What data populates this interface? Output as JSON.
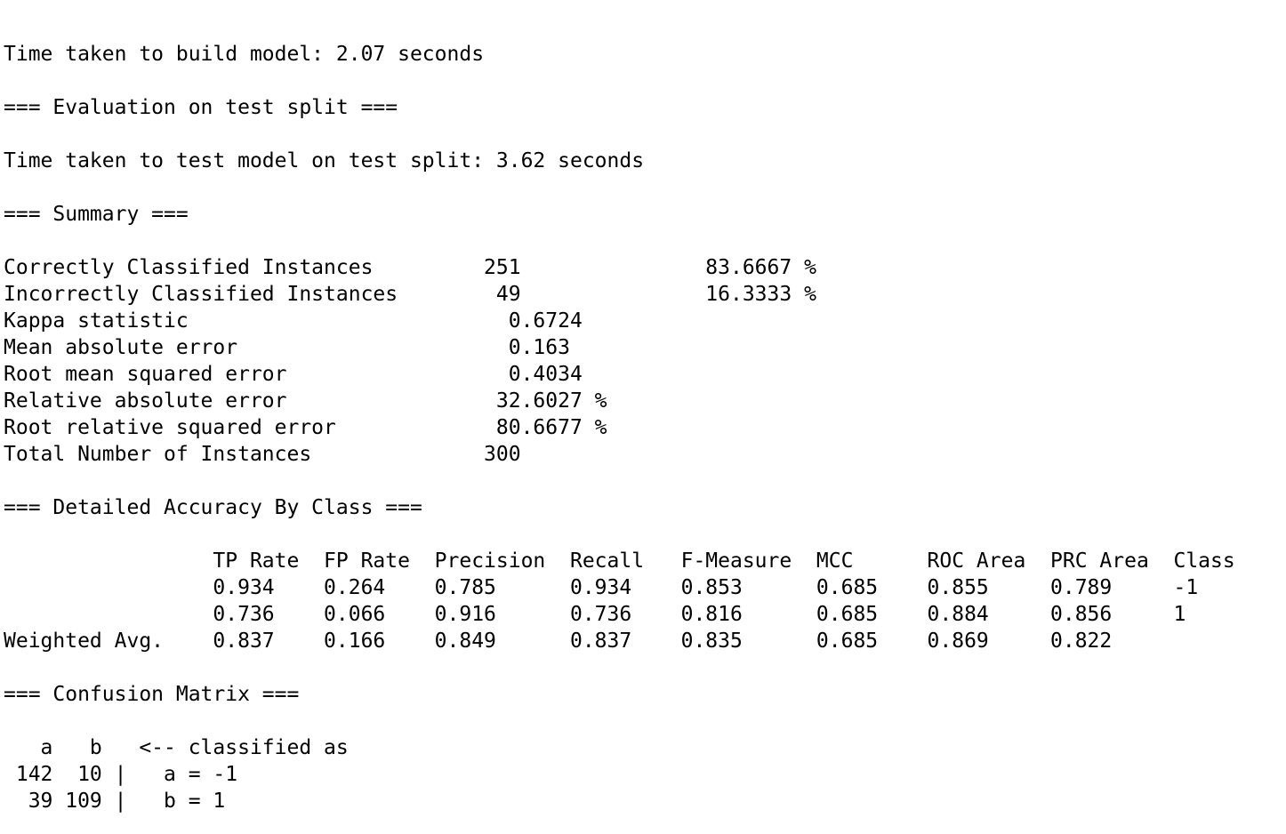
{
  "output_lines": [
    "Time taken to build model: 2.07 seconds",
    "",
    "=== Evaluation on test split ===",
    "",
    "Time taken to test model on test split: 3.62 seconds",
    "",
    "=== Summary ===",
    "",
    "Correctly Classified Instances         251               83.6667 %",
    "Incorrectly Classified Instances        49               16.3333 %",
    "Kappa statistic                          0.6724",
    "Mean absolute error                      0.163",
    "Root mean squared error                  0.4034",
    "Relative absolute error                 32.6027 %",
    "Root relative squared error             80.6677 %",
    "Total Number of Instances              300",
    "",
    "=== Detailed Accuracy By Class ===",
    "",
    "                 TP Rate  FP Rate  Precision  Recall   F-Measure  MCC      ROC Area  PRC Area  Class",
    "                 0.934    0.264    0.785      0.934    0.853      0.685    0.855     0.789     -1",
    "                 0.736    0.066    0.916      0.736    0.816      0.685    0.884     0.856     1",
    "Weighted Avg.    0.837    0.166    0.849      0.837    0.835      0.685    0.869     0.822",
    "",
    "=== Confusion Matrix ===",
    "",
    "   a   b   <-- classified as",
    " 142  10 |   a = -1",
    "  39 109 |   b = 1"
  ]
}
